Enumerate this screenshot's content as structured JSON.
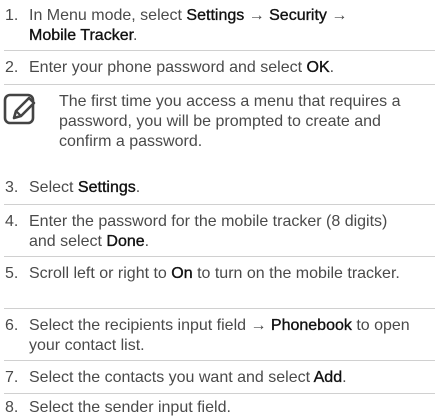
{
  "steps": [
    {
      "num": "1.",
      "pre": "In Menu mode, select ",
      "b1": "Settings",
      "mid1": " → ",
      "b2": "Security",
      "mid2": " → ",
      "b3": "Mobile Tracker",
      "post": "."
    },
    {
      "num": "2.",
      "pre": "Enter your phone password and select ",
      "b1": "OK",
      "post": "."
    },
    {
      "num": "3.",
      "pre": "Select ",
      "b1": "Settings",
      "post": "."
    },
    {
      "num": "4.",
      "pre": "Enter the password for the mobile tracker (8 digits) and select ",
      "b1": "Done",
      "post": "."
    },
    {
      "num": "5.",
      "pre": "Scroll left or right to ",
      "b1": "On",
      "post": " to turn on the mobile tracker."
    },
    {
      "num": "6.",
      "pre": "Select the recipients input field → ",
      "b1": "Phonebook",
      "post": " to open your contact list."
    },
    {
      "num": "7.",
      "pre": "Select the contacts you want and select ",
      "b1": "Add",
      "post": "."
    },
    {
      "num": "8.",
      "pre": "Select the sender input field.",
      "post": ""
    }
  ],
  "note": {
    "icon": "note-pencil-icon",
    "text": "The first time you access a menu that requires a password, you will be prompted to create and confirm a password."
  },
  "colors": {
    "text": "#4a4a4a",
    "bold": "#111111",
    "rule": "#d0d0d0"
  }
}
